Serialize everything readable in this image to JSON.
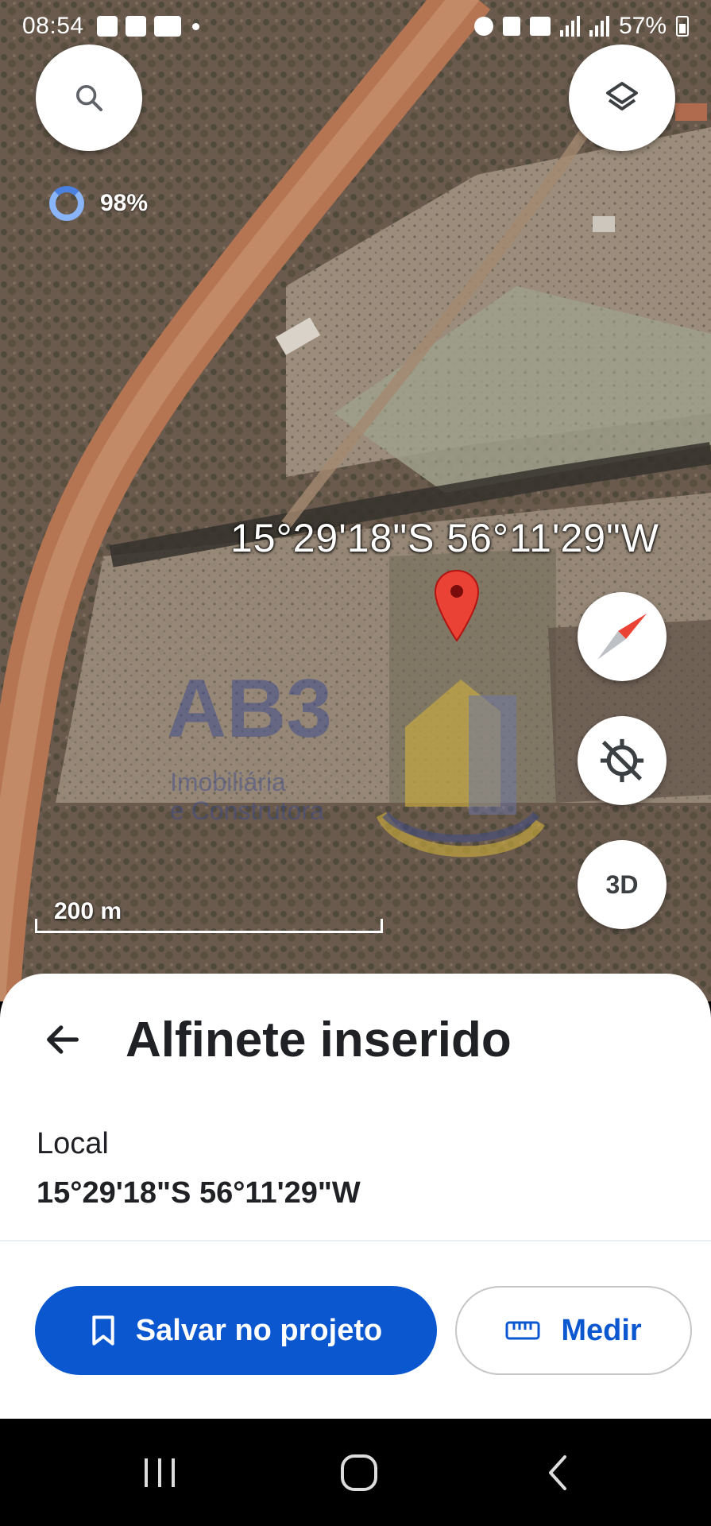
{
  "status_bar": {
    "time": "08:54",
    "battery": "57%",
    "notification_icons": [
      "gallery-icon",
      "checkbox-icon",
      "voicemail-icon",
      "dot-icon"
    ],
    "system_icons": [
      "alarm-icon",
      "mute-icon",
      "5g-icon",
      "signal-icon",
      "signal-icon",
      "battery-icon"
    ]
  },
  "map": {
    "loading_percent": "98%",
    "coordinate_label": "15°29'18\"S 56°11'29\"W",
    "scale_label": "200 m",
    "watermark": {
      "title": "AB3",
      "subtitle_line1": "Imobiliária",
      "subtitle_line2": "e Construtora"
    },
    "controls": {
      "search_icon": "search-icon",
      "layers_icon": "layers-icon",
      "compass_icon": "compass-icon",
      "location_icon": "location-off-icon",
      "threed_label": "3D"
    }
  },
  "sheet": {
    "title": "Alfinete inserido",
    "location_label": "Local",
    "location_value": "15°29'18\"S 56°11'29\"W",
    "save_button": "Salvar no projeto",
    "measure_button": "Medir"
  },
  "colors": {
    "primary_blue": "#0b57d0",
    "pin_red": "#ea4335",
    "loading_blue": "#8ab4f8"
  }
}
